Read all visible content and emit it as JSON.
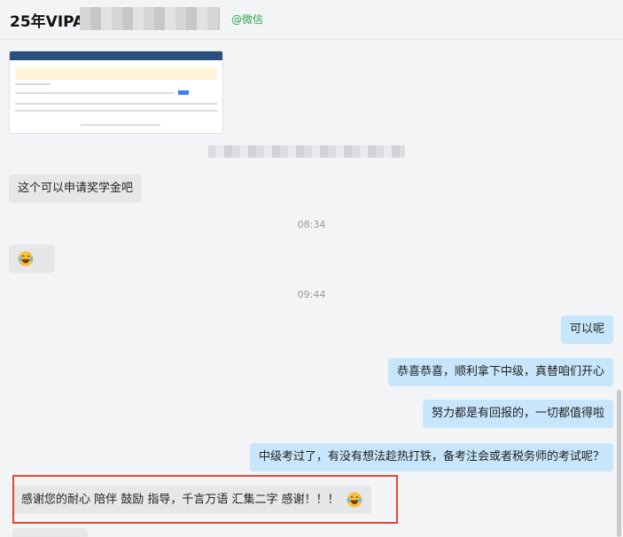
{
  "header": {
    "title": "25年VIPA",
    "source_tag": "@微信"
  },
  "messages": {
    "m1": "这个可以申请奖学金吧",
    "t1": "08:34",
    "t2": "09:44",
    "r1": "可以呢",
    "r2": "恭喜恭喜，顺利拿下中级，真替咱们开心",
    "r3": "努力都是有回报的，一切都值得啦",
    "r4": "中级考过了，有没有想法趁热打铁，备考注会或者税务师的考试呢？",
    "m3": "感谢您的耐心 陪伴 鼓励 指导，千言万语 汇集二字 感谢！！！"
  },
  "icons": {
    "emoji": "laughing-tears-emoji"
  },
  "colors": {
    "left_bubble": "#e6e7e9",
    "right_bubble": "#c7e6fb",
    "highlight": "#e2493a",
    "wechat_green": "#2fa54b"
  }
}
